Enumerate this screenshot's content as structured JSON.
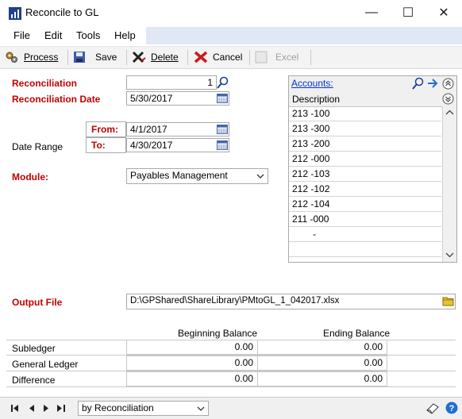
{
  "window": {
    "title": "Reconcile to GL"
  },
  "menu": [
    "File",
    "Edit",
    "Tools",
    "Help"
  ],
  "toolbar": {
    "process": "Process",
    "save": "Save",
    "delete": "Delete",
    "cancel": "Cancel",
    "excel": "Excel"
  },
  "form": {
    "reconciliation_label": "Reconciliation",
    "reconciliation_value": "1",
    "reconciliation_date_label": "Reconciliation Date",
    "reconciliation_date_value": "5/30/2017",
    "date_range_label": "Date Range",
    "from_label": "From:",
    "from_value": "4/1/2017",
    "to_label": "To:",
    "to_value": "4/30/2017",
    "module_label": "Module:",
    "module_value": "Payables Management",
    "output_file_label": "Output File",
    "output_file_value": "D:\\GPShared\\ShareLibrary\\PMtoGL_1_042017.xlsx"
  },
  "accounts": {
    "header_link": "Accounts:",
    "column": "Description",
    "rows": [
      "213 -100",
      "213 -300",
      "213 -200",
      "212 -000",
      "212 -103",
      "212 -102",
      "212 -104",
      "211 -000",
      "-"
    ]
  },
  "balances": {
    "beginning_header": "Beginning Balance",
    "ending_header": "Ending Balance",
    "rows": [
      {
        "label": "Subledger",
        "beginning": "0.00",
        "ending": "0.00"
      },
      {
        "label": "General Ledger",
        "beginning": "0.00",
        "ending": "0.00"
      },
      {
        "label": "Difference",
        "beginning": "0.00",
        "ending": "0.00"
      }
    ]
  },
  "footer": {
    "sort_value": "by Reconciliation"
  },
  "colors": {
    "required_label": "#c00000",
    "menubar_fill": "#dfe8f4",
    "link": "#0033cc"
  }
}
